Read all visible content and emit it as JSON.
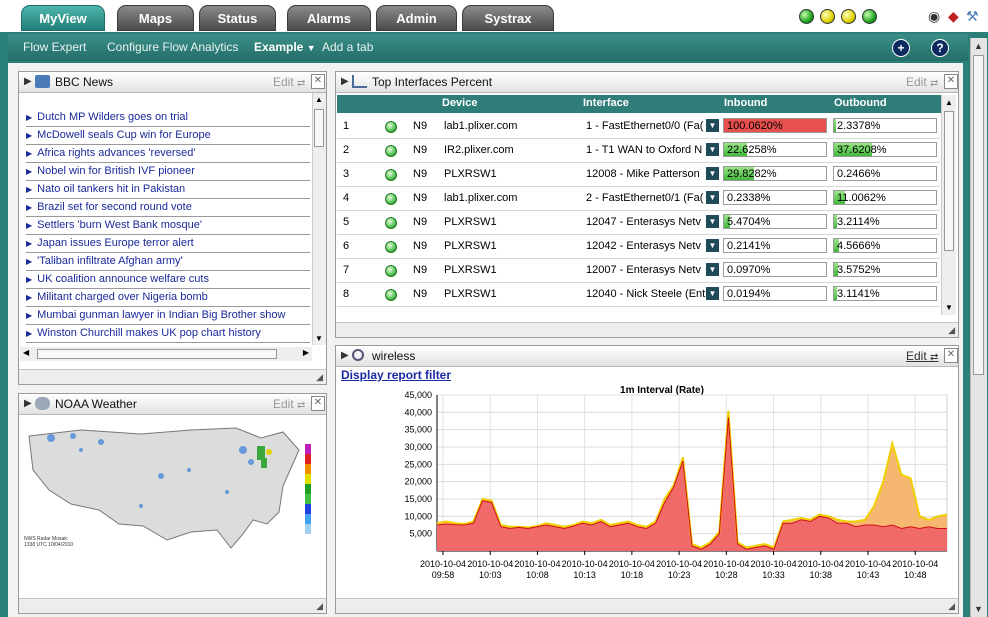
{
  "tabs": [
    {
      "label": "MyView",
      "active": true
    },
    {
      "label": "Maps",
      "active": false
    },
    {
      "label": "Status",
      "active": false
    },
    {
      "label": "Alarms",
      "active": false
    },
    {
      "label": "Admin",
      "active": false
    },
    {
      "label": "Systrax",
      "active": false
    }
  ],
  "status_lights": [
    "green",
    "yellow",
    "yellow",
    "green"
  ],
  "subnav": {
    "flow_expert": "Flow Expert",
    "configure": "Configure Flow Analytics",
    "example": "Example",
    "add_tab": "Add a tab",
    "plus": "+",
    "help": "?"
  },
  "bbc": {
    "title": "BBC News",
    "edit": "Edit",
    "items": [
      "Dutch MP Wilders goes on trial",
      "McDowell seals Cup win for Europe",
      "Africa rights advances 'reversed'",
      "Nobel win for British IVF pioneer",
      "Nato oil tankers hit in Pakistan",
      "Brazil set for second round vote",
      "Settlers 'burn West Bank mosque'",
      "Japan issues Europe terror alert",
      "'Taliban infiltrate Afghan army'",
      "UK coalition announce welfare cuts",
      "Militant charged over Nigeria bomb",
      "Mumbai gunman lawyer in Indian Big Brother show",
      "Winston Churchill makes UK pop chart history"
    ]
  },
  "noaa": {
    "title": "NOAA Weather",
    "edit": "Edit",
    "caption1": "NWS Radar Mosaic",
    "caption2": "1338 UTC 10/04/2010"
  },
  "top_interfaces": {
    "title": "Top Interfaces Percent",
    "edit": "Edit",
    "columns": {
      "device": "Device",
      "interface": "Interface",
      "inbound": "Inbound",
      "outbound": "Outbound"
    },
    "rows": [
      {
        "num": "1",
        "type": "N9",
        "device": "lab1.plixer.com",
        "iface": "1 - FastEthernet0/0 (Fa(",
        "in": "100.0620%",
        "in_val": 100.062,
        "out": "2.3378%",
        "out_val": 2.3378
      },
      {
        "num": "2",
        "type": "N9",
        "device": "IR2.plixer.com",
        "iface": "1 - T1 WAN to Oxford N",
        "in": "22.6258%",
        "in_val": 22.6258,
        "out": "37.6208%",
        "out_val": 37.6208
      },
      {
        "num": "3",
        "type": "N9",
        "device": "PLXRSW1",
        "iface": "12008 - Mike Patterson",
        "in": "29.8282%",
        "in_val": 29.8282,
        "out": "0.2466%",
        "out_val": 0.2466
      },
      {
        "num": "4",
        "type": "N9",
        "device": "lab1.plixer.com",
        "iface": "2 - FastEthernet0/1 (Fa(",
        "in": "0.2338%",
        "in_val": 0.2338,
        "out": "11.0062%",
        "out_val": 11.0062
      },
      {
        "num": "5",
        "type": "N9",
        "device": "PLXRSW1",
        "iface": "12047 - Enterasys Netv",
        "in": "5.4704%",
        "in_val": 5.4704,
        "out": "3.2114%",
        "out_val": 3.2114
      },
      {
        "num": "6",
        "type": "N9",
        "device": "PLXRSW1",
        "iface": "12042 - Enterasys Netv",
        "in": "0.2141%",
        "in_val": 0.2141,
        "out": "4.5666%",
        "out_val": 4.5666
      },
      {
        "num": "7",
        "type": "N9",
        "device": "PLXRSW1",
        "iface": "12007 - Enterasys Netv",
        "in": "0.0970%",
        "in_val": 0.097,
        "out": "3.5752%",
        "out_val": 3.5752
      },
      {
        "num": "8",
        "type": "N9",
        "device": "PLXRSW1",
        "iface": "12040 - Nick Steele (Ent",
        "in": "0.0194%",
        "in_val": 0.0194,
        "out": "3.1141%",
        "out_val": 3.1141
      }
    ]
  },
  "wireless": {
    "title": "wireless",
    "edit": "Edit",
    "filter_link": "Display report filter"
  },
  "chart_data": {
    "type": "area",
    "title": "1m Interval (Rate)",
    "xlabel": "",
    "ylabel": "",
    "ylim": [
      0,
      45000
    ],
    "yticks": [
      "45,000",
      "40,000",
      "35,000",
      "30,000",
      "25,000",
      "20,000",
      "15,000",
      "10,000",
      "5,000"
    ],
    "xticks": [
      "2010-10-04 09:58",
      "2010-10-04 10:03",
      "2010-10-04 10:08",
      "2010-10-04 10:13",
      "2010-10-04 10:18",
      "2010-10-04 10:23",
      "2010-10-04 10:28",
      "2010-10-04 10:33",
      "2010-10-04 10:38",
      "2010-10-04 10:43",
      "2010-10-04 10:48"
    ],
    "colors": {
      "series1": "#f06a6a",
      "series2": "#f5b060",
      "line2": "#f0d000",
      "line1": "#d01010"
    },
    "series": [
      {
        "values": [
          7500,
          7800,
          7600,
          7500,
          8000,
          14500,
          14000,
          7000,
          6500,
          6800,
          6500,
          7000,
          7500,
          7000,
          6500,
          7200,
          8000,
          7500,
          8500,
          7000,
          7500,
          8000,
          7000,
          6500,
          8000,
          14000,
          18500,
          26000,
          1500,
          500,
          2000,
          5000,
          38500,
          2000,
          500,
          1000,
          1500,
          500,
          8000,
          8000,
          9000,
          8500,
          10000,
          9500,
          8000,
          8000,
          7000,
          7500,
          7500,
          7000,
          7500,
          6500,
          7000,
          6500,
          7000,
          6500,
          6500
        ],
        "top": [
          8000,
          8500,
          8000,
          7800,
          8500,
          15000,
          14500,
          7500,
          7000,
          7000,
          6800,
          7200,
          8000,
          7500,
          7000,
          7500,
          8500,
          8000,
          9000,
          7500,
          8000,
          8500,
          7500,
          7000,
          8500,
          15000,
          19000,
          27000,
          2000,
          1000,
          2500,
          5500,
          40500,
          2500,
          1000,
          1500,
          2000,
          1000,
          8500,
          9000,
          9500,
          9000,
          10500,
          10000,
          9000,
          8500,
          8500,
          9000,
          13000,
          20000,
          31000,
          22000,
          21000,
          10000,
          9000,
          10000,
          10500
        ]
      }
    ]
  }
}
